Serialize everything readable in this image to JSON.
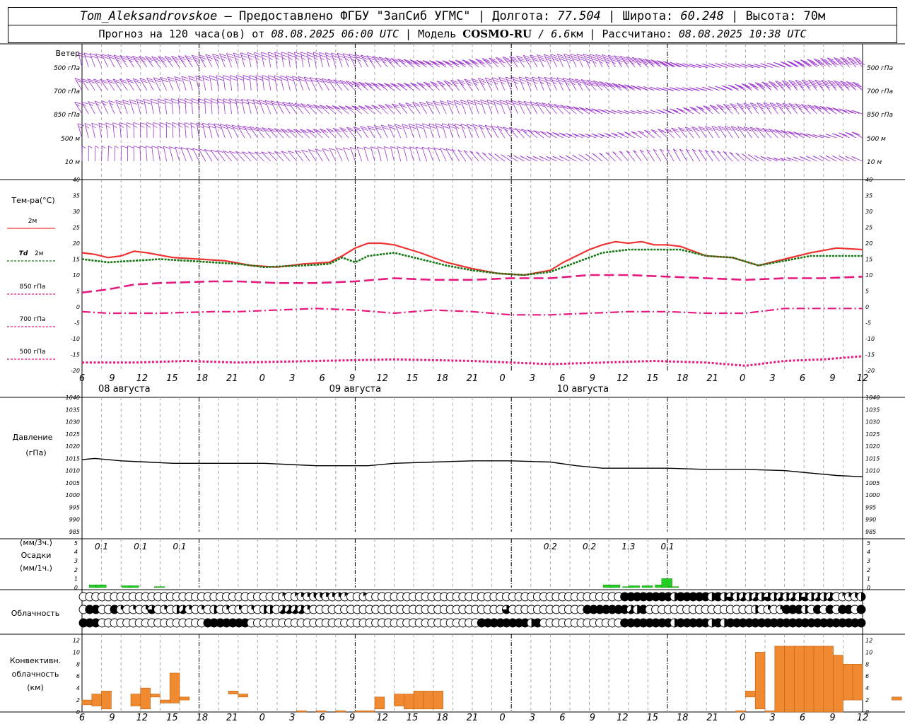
{
  "header": {
    "station": "Tom_Aleksandrovskoe",
    "provided_by": " — Предоставлено ФГБУ \"ЗапСиб УГМС\"",
    "lon_label": "Долгота:",
    "lon_value": "77.504",
    "lat_label": "Широта:",
    "lat_value": "60.248",
    "alt_label": "Высота:",
    "alt_value": "70м",
    "forecast_prefix": "Прогноз на 120 часа(ов) от ",
    "forecast_start": "08.08.2025 06:00 UTC",
    "model_label": "Модель ",
    "model_name": "COSMO-RU",
    "model_res": " / 6.6",
    "model_res_unit": "км",
    "computed_label": "Рассчитано: ",
    "computed_value": "08.08.2025 10:38 UTC"
  },
  "colors": {
    "wind": "#9a33cc",
    "t2m": "#ee3333",
    "td2m": "#117711",
    "t850": "#e6197e",
    "t700": "#e6197e",
    "t500": "#e6197e",
    "pressure": "#000000",
    "precip": "#22cc22",
    "convective": "#f08a30",
    "grid": "#aaaaaa"
  },
  "chart_data": [
    {
      "type": "barbs",
      "panel": "wind",
      "title": "Ветер",
      "levels": [
        "500 гПа",
        "700 гПа",
        "850 гПа",
        "500 м",
        "10  м"
      ],
      "units": "knots (barbs)",
      "x_hours": [
        0,
        12,
        24,
        36,
        48,
        54,
        60,
        72,
        84,
        96,
        108,
        120
      ],
      "speed_knots": [
        [
          20,
          25,
          25,
          25,
          25,
          30,
          30,
          30,
          35,
          40,
          40,
          40
        ],
        [
          20,
          20,
          20,
          20,
          25,
          25,
          25,
          25,
          30,
          30,
          35,
          35
        ],
        [
          15,
          20,
          20,
          20,
          20,
          20,
          20,
          20,
          20,
          25,
          25,
          25
        ],
        [
          15,
          15,
          20,
          20,
          20,
          20,
          15,
          15,
          15,
          20,
          20,
          20
        ],
        [
          5,
          10,
          10,
          10,
          10,
          10,
          5,
          5,
          5,
          5,
          5,
          5
        ]
      ]
    },
    {
      "type": "line",
      "panel": "temperature",
      "title": "Тем-ра(°C)",
      "ylim": [
        -20,
        40
      ],
      "yticks": [
        40,
        35,
        30,
        25,
        20,
        15,
        10,
        5,
        0,
        -5,
        -10,
        -15,
        -20
      ],
      "series": [
        {
          "name": "2м",
          "x": [
            0,
            2,
            4,
            6,
            8,
            10,
            14,
            18,
            22,
            26,
            30,
            34,
            38,
            40,
            42,
            44,
            46,
            48,
            52,
            56,
            60,
            64,
            68,
            72,
            74,
            76,
            78,
            80,
            82,
            84,
            86,
            88,
            90,
            92,
            94,
            96,
            100,
            104,
            108,
            112,
            116,
            120
          ],
          "values": [
            17,
            16.5,
            15.5,
            16,
            17.5,
            17,
            15.5,
            15,
            14.5,
            13,
            12.5,
            13.5,
            14,
            16,
            18.5,
            20,
            20,
            19.5,
            17,
            14,
            12,
            10.5,
            10,
            11.5,
            14,
            16,
            18,
            19.5,
            20.5,
            20,
            20.5,
            19.5,
            19.5,
            19,
            17.5,
            16,
            15.5,
            13,
            15,
            17,
            18.5,
            18
          ]
        },
        {
          "name": "Td  2м",
          "x": [
            0,
            4,
            8,
            12,
            20,
            24,
            28,
            34,
            38,
            40,
            42,
            44,
            48,
            52,
            56,
            60,
            64,
            68,
            72,
            76,
            80,
            84,
            88,
            92,
            96,
            100,
            104,
            108,
            112,
            116,
            120
          ],
          "values": [
            15,
            14,
            14.5,
            15,
            14,
            13.5,
            12.5,
            13,
            13.5,
            15.5,
            14,
            16,
            17,
            15,
            13,
            11.5,
            10.5,
            10,
            11,
            14,
            17,
            18,
            18,
            18,
            16,
            15.5,
            13,
            14.5,
            16,
            16,
            16
          ]
        },
        {
          "name": "850 гПа",
          "x": [
            0,
            4,
            8,
            12,
            20,
            24,
            30,
            36,
            42,
            48,
            54,
            60,
            66,
            72,
            78,
            84,
            90,
            96,
            102,
            108,
            114,
            120
          ],
          "values": [
            4.5,
            5.5,
            7,
            7.5,
            8,
            8,
            7.5,
            7.5,
            8,
            9,
            8.5,
            8.5,
            9,
            9,
            10,
            10,
            9.5,
            9,
            8.5,
            9,
            9,
            9.5
          ]
        },
        {
          "name": "700 гПа",
          "x": [
            0,
            4,
            8,
            12,
            20,
            24,
            30,
            36,
            42,
            48,
            54,
            60,
            66,
            72,
            78,
            84,
            90,
            96,
            102,
            108,
            114,
            120
          ],
          "values": [
            -1.5,
            -2,
            -2,
            -2,
            -1.5,
            -1.5,
            -1,
            -0.5,
            -1,
            -2,
            -1,
            -1.5,
            -2.5,
            -2.5,
            -2,
            -1.5,
            -1.5,
            -2,
            -2,
            -0.5,
            -0.5,
            -0.5
          ]
        },
        {
          "name": "500 гПа",
          "x": [
            0,
            8,
            16,
            24,
            36,
            48,
            60,
            66,
            72,
            80,
            88,
            96,
            102,
            108,
            114,
            120
          ],
          "values": [
            -17.5,
            -17.5,
            -17,
            -17.5,
            -17,
            -16.5,
            -17,
            -17.5,
            -18,
            -17.5,
            -17,
            -17.5,
            -18.5,
            -17,
            -16.5,
            -15.5
          ]
        }
      ]
    },
    {
      "type": "line",
      "panel": "pressure",
      "title": "Давление",
      "ylabel": "(гПа)",
      "ylim": [
        985,
        1040
      ],
      "yticks": [
        1040,
        1035,
        1030,
        1025,
        1020,
        1015,
        1010,
        1005,
        1000,
        995,
        990,
        985
      ],
      "series": [
        {
          "x": [
            0,
            2,
            4,
            6,
            10,
            14,
            20,
            24,
            28,
            32,
            36,
            44,
            48,
            54,
            60,
            66,
            72,
            76,
            80,
            84,
            90,
            96,
            102,
            108,
            112,
            116,
            120
          ],
          "values": [
            1014.5,
            1015,
            1014.5,
            1014,
            1013.5,
            1013,
            1013,
            1013,
            1013,
            1012.5,
            1012,
            1012,
            1013,
            1013.5,
            1014,
            1014,
            1013.5,
            1012,
            1011,
            1011,
            1011,
            1010.5,
            1010.5,
            1010,
            1009,
            1008,
            1007.5
          ]
        }
      ]
    },
    {
      "type": "bar",
      "panel": "precipitation",
      "title": "Осадки",
      "ylabel_top": "(мм/3ч.)",
      "ylabel_bottom": "(мм/1ч.)",
      "ylim": [
        0,
        5
      ],
      "yticks": [
        5,
        4,
        3,
        2,
        1,
        0
      ],
      "x": [
        1,
        2,
        6,
        7,
        11,
        80,
        81,
        83,
        84,
        86,
        88,
        89,
        90
      ],
      "values": [
        0.3,
        0.3,
        0.2,
        0.2,
        0.1,
        0.3,
        0.3,
        0.1,
        0.2,
        0.2,
        0.3,
        1,
        0.1
      ],
      "labels_3h": [
        {
          "x": 3,
          "text": "0.1"
        },
        {
          "x": 9,
          "text": "0.1"
        },
        {
          "x": 15,
          "text": "0.1"
        },
        {
          "x": 72,
          "text": "0.2"
        },
        {
          "x": 78,
          "text": "0.2"
        },
        {
          "x": 84,
          "text": "1.3"
        },
        {
          "x": 90,
          "text": "0.1"
        }
      ]
    },
    {
      "type": "symbols",
      "panel": "cloudiness",
      "title": "Облачность",
      "rows": [
        "upper",
        "middle",
        "lower"
      ],
      "cover_0_to_8": [
        "000000000000000000000000000000001012233222100100000000000000000000000000000000000000000888888884888884846454546454546454501234",
        "088008202026020452020402020204405555200000000000000000000000000000006000000000000888888854800000000000000000402028884080808808",
        "888000000000000000008888888000000000000000000000000000000000000088888888480000000000000888888884888884848888888888888888888888"
      ]
    },
    {
      "type": "bar",
      "panel": "convective",
      "title": "Конвективн.",
      "ylabel": "облачность",
      "unit": "(км)",
      "ylim": [
        0,
        13
      ],
      "yticks": [
        12,
        10,
        8,
        6,
        4,
        2,
        0
      ],
      "bars": [
        {
          "x": 0,
          "bottom": 1.2,
          "top": 2
        },
        {
          "x": 1,
          "bottom": 1,
          "top": 3
        },
        {
          "x": 2,
          "bottom": 0.5,
          "top": 3.5
        },
        {
          "x": 5,
          "bottom": 1,
          "top": 3
        },
        {
          "x": 6,
          "bottom": 0.5,
          "top": 4
        },
        {
          "x": 7,
          "bottom": 2.5,
          "top": 3
        },
        {
          "x": 8,
          "bottom": 1.5,
          "top": 2
        },
        {
          "x": 9,
          "bottom": 1.5,
          "top": 6.5
        },
        {
          "x": 10,
          "bottom": 2,
          "top": 2.5
        },
        {
          "x": 15,
          "bottom": 3,
          "top": 3.5
        },
        {
          "x": 16,
          "bottom": 2.5,
          "top": 3
        },
        {
          "x": 22,
          "bottom": 0,
          "top": 0.2
        },
        {
          "x": 24,
          "bottom": 0,
          "top": 0.2
        },
        {
          "x": 26,
          "bottom": 0,
          "top": 0.2
        },
        {
          "x": 28,
          "bottom": 0,
          "top": 0.2
        },
        {
          "x": 29,
          "bottom": 0,
          "top": 0.2
        },
        {
          "x": 30,
          "bottom": 0.5,
          "top": 2.5
        },
        {
          "x": 32,
          "bottom": 1,
          "top": 3
        },
        {
          "x": 33,
          "bottom": 0.5,
          "top": 3
        },
        {
          "x": 34,
          "bottom": 0.5,
          "top": 3.5
        },
        {
          "x": 35,
          "bottom": 0.5,
          "top": 3.5
        },
        {
          "x": 36,
          "bottom": 0.5,
          "top": 3.5
        },
        {
          "x": 67,
          "bottom": 0,
          "top": 0.2
        },
        {
          "x": 68,
          "bottom": 2.5,
          "top": 3.5
        },
        {
          "x": 69,
          "bottom": 0.5,
          "top": 10
        },
        {
          "x": 70,
          "bottom": 0,
          "top": 0.2
        },
        {
          "x": 71,
          "bottom": 0,
          "top": 11
        },
        {
          "x": 72,
          "bottom": 0,
          "top": 11
        },
        {
          "x": 73,
          "bottom": 0,
          "top": 11
        },
        {
          "x": 74,
          "bottom": 0,
          "top": 11
        },
        {
          "x": 75,
          "bottom": 0,
          "top": 11
        },
        {
          "x": 76,
          "bottom": 0,
          "top": 11
        },
        {
          "x": 77,
          "bottom": 0,
          "top": 9.5
        },
        {
          "x": 78,
          "bottom": 2,
          "top": 8
        },
        {
          "x": 79,
          "bottom": 2,
          "top": 8
        },
        {
          "x": 83,
          "bottom": 2,
          "top": 2.5
        },
        {
          "x": 85,
          "bottom": 0,
          "top": 0.2
        },
        {
          "x": 86,
          "bottom": 0,
          "top": 0.3
        },
        {
          "x": 87,
          "bottom": 0,
          "top": 0.4
        },
        {
          "x": 88,
          "bottom": 0,
          "top": 0.5
        },
        {
          "x": 89,
          "bottom": 0,
          "top": 0.7
        },
        {
          "x": 90,
          "bottom": 0.3,
          "top": 1
        },
        {
          "x": 91,
          "bottom": 0.5,
          "top": 1.2
        },
        {
          "x": 92,
          "bottom": 0.5,
          "top": 1.3
        },
        {
          "x": 93,
          "bottom": 0.5,
          "top": 1.3
        }
      ]
    }
  ],
  "time_axis": {
    "x_unit": "hours from 08.08.2025 06 UTC",
    "hour_labels": [
      "6",
      "9",
      "12",
      "15",
      "18",
      "21",
      "0",
      "3",
      "6",
      "9",
      "12",
      "15",
      "18",
      "21",
      "0",
      "3",
      "6",
      "9",
      "12",
      "15",
      "18",
      "21",
      "0",
      "3",
      "6",
      "9",
      "12"
    ],
    "day_labels": [
      {
        "x": 6,
        "text": "08 августа"
      },
      {
        "x": 30,
        "text": "09 августа"
      },
      {
        "x": 54,
        "text": "10 августа"
      }
    ],
    "midnights": [
      18,
      42,
      66,
      90
    ]
  },
  "legend": {
    "t2m": "2м",
    "td2m_a": "Td",
    "td2m_b": "  2м",
    "t850": "850 гПа",
    "t700": "700 гПа",
    "t500": "500 гПа"
  }
}
